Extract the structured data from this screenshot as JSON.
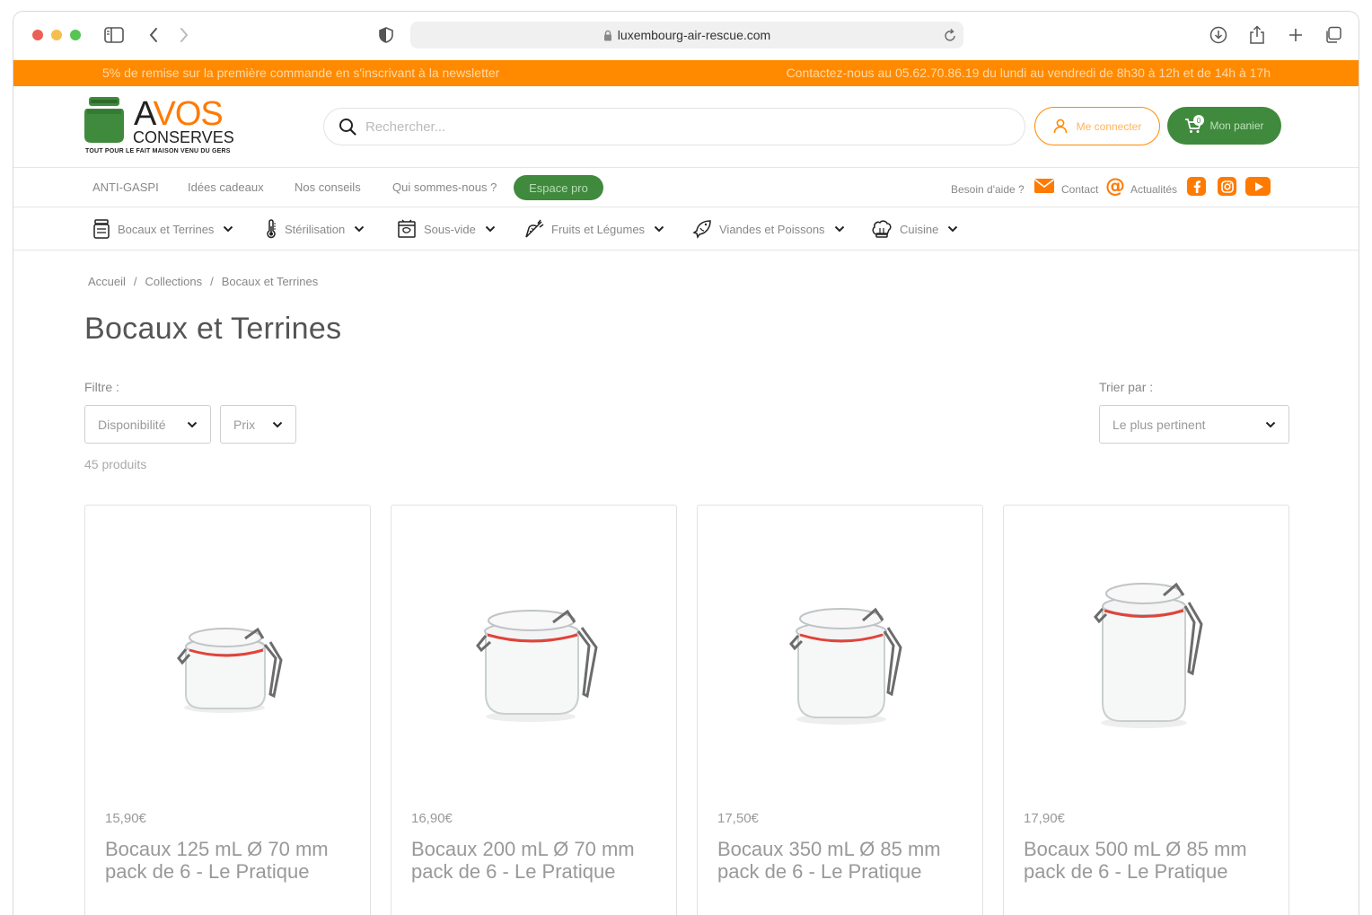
{
  "browser": {
    "url": "luxembourg-air-rescue.com"
  },
  "promo": {
    "left": "5% de remise sur la première commande en s'inscrivant à la newsletter",
    "right": "Contactez-nous au 05.62.70.86.19 du lundi au vendredi de 8h30 à 12h et de 14h à 17h"
  },
  "header": {
    "logo_a": "A",
    "logo_vos": "VOS",
    "logo_conserves": "CONSERVES",
    "logo_tagline": "TOUT POUR LE FAIT MAISON VENU DU GERS",
    "search_placeholder": "Rechercher...",
    "login_label": "Me connecter",
    "cart_label": "Mon panier",
    "cart_count": "0"
  },
  "secondary_nav": {
    "links": [
      "ANTI-GASPI",
      "Idées cadeaux",
      "Nos conseils",
      "Qui sommes-nous ?"
    ],
    "pro_label": "Espace pro",
    "help_label": "Besoin d'aide ?",
    "contact_label": "Contact",
    "news_label": "Actualités"
  },
  "categories": [
    {
      "label": "Bocaux et Terrines",
      "icon": "jar-icon"
    },
    {
      "label": "Stérilisation",
      "icon": "thermometer-icon"
    },
    {
      "label": "Sous-vide",
      "icon": "vacuum-bag-icon"
    },
    {
      "label": "Fruits et Légumes",
      "icon": "carrot-icon"
    },
    {
      "label": "Viandes et Poissons",
      "icon": "fish-icon"
    },
    {
      "label": "Cuisine",
      "icon": "chef-hat-icon"
    }
  ],
  "breadcrumb": [
    "Accueil",
    "Collections",
    "Bocaux et Terrines"
  ],
  "page_title": "Bocaux et Terrines",
  "filters": {
    "label": "Filtre :",
    "availability": "Disponibilité",
    "price": "Prix",
    "sort_label": "Trier par :",
    "sort_value": "Le plus pertinent",
    "count": "45 produits"
  },
  "products": [
    {
      "price": "15,90€",
      "name": "Bocaux 125 mL Ø 70 mm pack de 6 - Le Pratique"
    },
    {
      "price": "16,90€",
      "name": "Bocaux 200 mL Ø 70 mm pack de 6 - Le Pratique"
    },
    {
      "price": "17,50€",
      "name": "Bocaux 350 mL Ø 85 mm pack de 6 - Le Pratique"
    },
    {
      "price": "17,90€",
      "name": "Bocaux 500 mL Ø 85 mm pack de 6 - Le Pratique"
    }
  ],
  "colors": {
    "orange": "#ff8a00",
    "green": "#3f8a3c"
  }
}
